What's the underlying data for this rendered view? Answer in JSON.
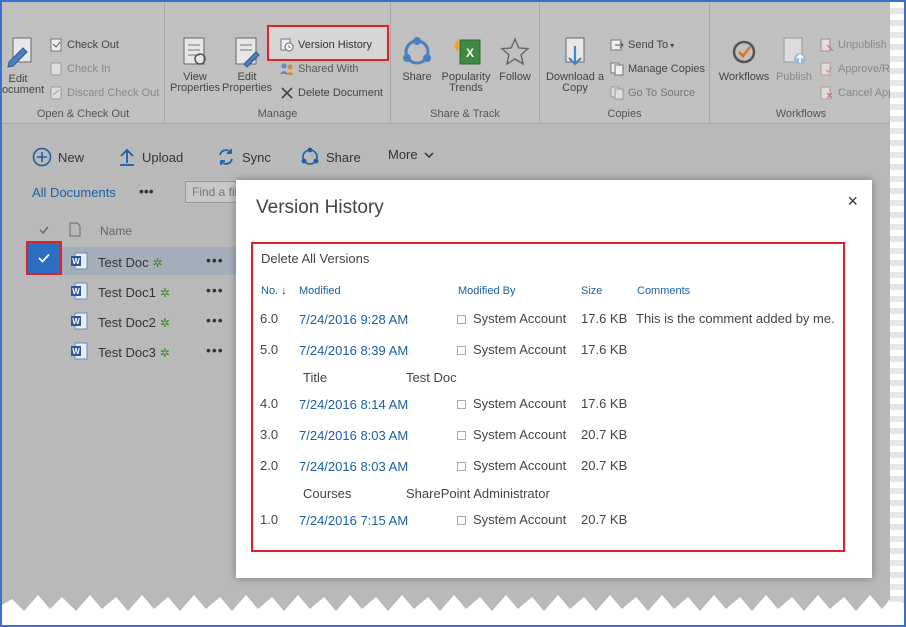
{
  "ribbon": {
    "groups": {
      "open_checkout": {
        "label": "Open & Check Out",
        "edit_document": "Edit\nDocument",
        "check_out": "Check Out",
        "check_in": "Check In",
        "discard_check_out": "Discard Check Out"
      },
      "manage": {
        "label": "Manage",
        "view_properties": "View\nProperties",
        "edit_properties": "Edit\nProperties",
        "version_history": "Version History",
        "shared_with": "Shared With",
        "delete_document": "Delete Document"
      },
      "share_track": {
        "label": "Share & Track",
        "share": "Share",
        "popularity_trends": "Popularity\nTrends",
        "follow": "Follow"
      },
      "copies": {
        "label": "Copies",
        "download_a_copy": "Download a\nCopy",
        "send_to": "Send To",
        "manage_copies": "Manage Copies",
        "go_to_source": "Go To Source"
      },
      "workflows": {
        "label": "Workflows",
        "workflows": "Workflows",
        "publish": "Publish",
        "unpublish": "Unpublish",
        "approve_reject": "Approve/Re",
        "cancel_approval": "Cancel App"
      }
    }
  },
  "commandbar": {
    "new": "New",
    "upload": "Upload",
    "sync": "Sync",
    "share": "Share",
    "more": "More"
  },
  "view": {
    "all_documents": "All Documents",
    "dots": "•••",
    "find_placeholder": "Find a fil"
  },
  "list": {
    "name_header": "Name",
    "documents": [
      {
        "name": "Test Doc",
        "selected": true
      },
      {
        "name": "Test Doc1",
        "selected": false
      },
      {
        "name": "Test Doc2",
        "selected": false
      },
      {
        "name": "Test Doc3",
        "selected": false
      }
    ],
    "new_marker": "✲",
    "row_dots": "•••"
  },
  "dialog": {
    "title": "Version History",
    "close": "×",
    "delete_all": "Delete All Versions",
    "headers": {
      "no": "No.",
      "modified": "Modified",
      "modified_by": "Modified By",
      "size": "Size",
      "comments": "Comments"
    },
    "versions": [
      {
        "no": "6.0",
        "modified": "7/24/2016 9:28 AM",
        "by": "System Account",
        "size": "17.6 KB",
        "comment": "This is the comment added by me."
      },
      {
        "no": "5.0",
        "modified": "7/24/2016 8:39 AM",
        "by": "System Account",
        "size": "17.6 KB",
        "comment": ""
      },
      {
        "no": "4.0",
        "modified": "7/24/2016 8:14 AM",
        "by": "System Account",
        "size": "17.6 KB",
        "comment": ""
      },
      {
        "no": "3.0",
        "modified": "7/24/2016 8:03 AM",
        "by": "System Account",
        "size": "20.7 KB",
        "comment": ""
      },
      {
        "no": "2.0",
        "modified": "7/24/2016 8:03 AM",
        "by": "System Account",
        "size": "20.7 KB",
        "comment": ""
      },
      {
        "no": "1.0",
        "modified": "7/24/2016 7:15 AM",
        "by": "System Account",
        "size": "20.7 KB",
        "comment": ""
      }
    ],
    "changes": [
      {
        "field": "Title",
        "value": "Test Doc"
      },
      {
        "field": "Courses",
        "value": "SharePoint Administrator"
      }
    ]
  },
  "colors": {
    "accent": "#1a5fa8",
    "highlight": "#e0202a",
    "ribbon_bg": "#c0c0c0"
  }
}
